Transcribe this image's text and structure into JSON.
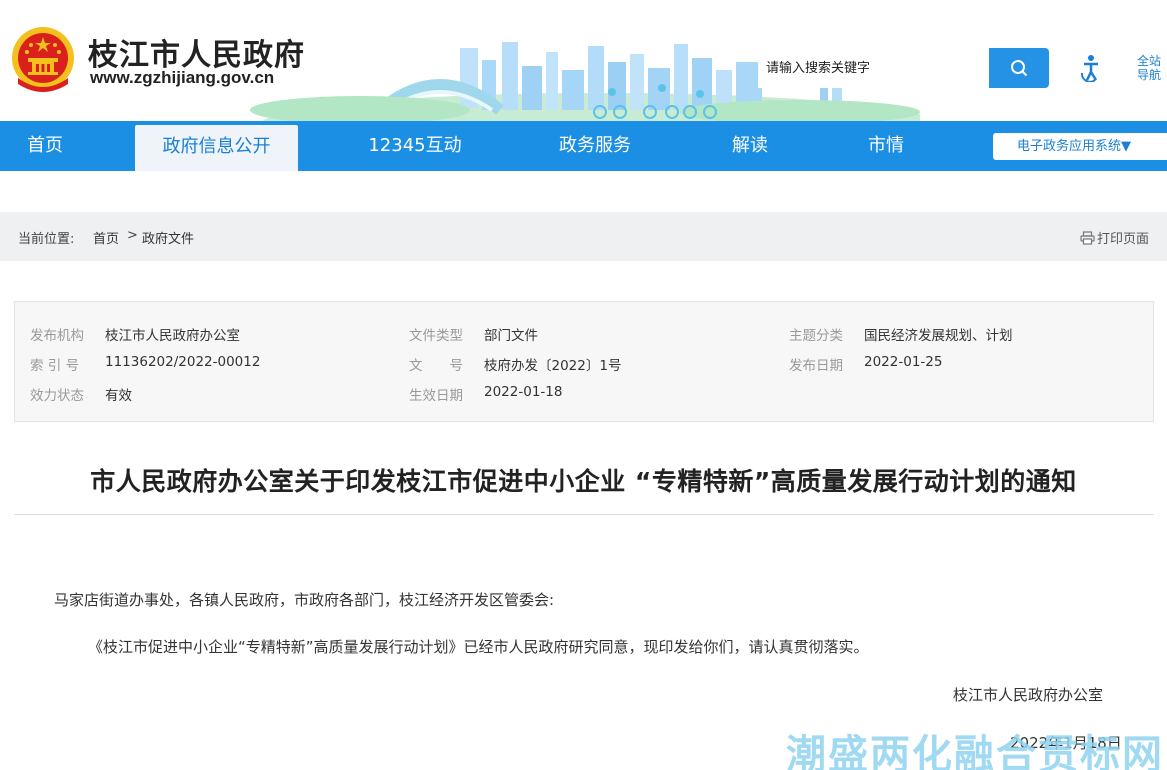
{
  "header": {
    "site_name": "枝江市人民政府",
    "site_domain": "www.zgzhijiang.gov.cn",
    "search_placeholder": "请输入搜索关键字",
    "sitenav_label": "全站导航"
  },
  "nav": {
    "items": [
      "首页",
      "政府信息公开",
      "12345互动",
      "政务服务",
      "解读",
      "市情"
    ],
    "active": "政府信息公开",
    "eapp_label": "电子政务应用系统▼"
  },
  "breadcrumb": {
    "label": "当前位置:",
    "home": "首页",
    "separator": ">",
    "current": "政府文件",
    "print_label": "打印页面"
  },
  "info": {
    "publisher_key": "发布机构",
    "publisher": "枝江市人民政府办公室",
    "doc_type_key": "文件类型",
    "doc_type": "部门文件",
    "topic_key": "主题分类",
    "topic": "国民经济发展规划、计划",
    "index_key": "索 引 号",
    "index": "11136202/2022-00012",
    "doc_no_key": "文　　号",
    "doc_no": "枝府办发〔2022〕1号",
    "publish_date_key": "发布日期",
    "publish_date": "2022-01-25",
    "status_key": "效力状态",
    "status": "有效",
    "effective_date_key": "生效日期",
    "effective_date": "2022-01-18"
  },
  "document": {
    "title": "市人民政府办公室关于印发枝江市促进中小企业 “专精特新”高质量发展行动计划的通知",
    "salutation": "马家店街道办事处，各镇人民政府，市政府各部门，枝江经济开发区管委会:",
    "paragraph1": "《枝江市促进中小企业“专精特新”高质量发展行动计划》已经市人民政府研究同意，现印发给你们，请认真贯彻落实。",
    "signature": "枝江市人民政府办公室",
    "date": "2022年1月18日"
  },
  "watermark": "潮盛两化融合贯标网",
  "colors": {
    "nav_blue": "#1a8fe3",
    "search_blue": "#2592e6",
    "link_blue": "#1a7fd4",
    "emblem_red": "#d9201c",
    "emblem_gold": "#f4c01b"
  }
}
